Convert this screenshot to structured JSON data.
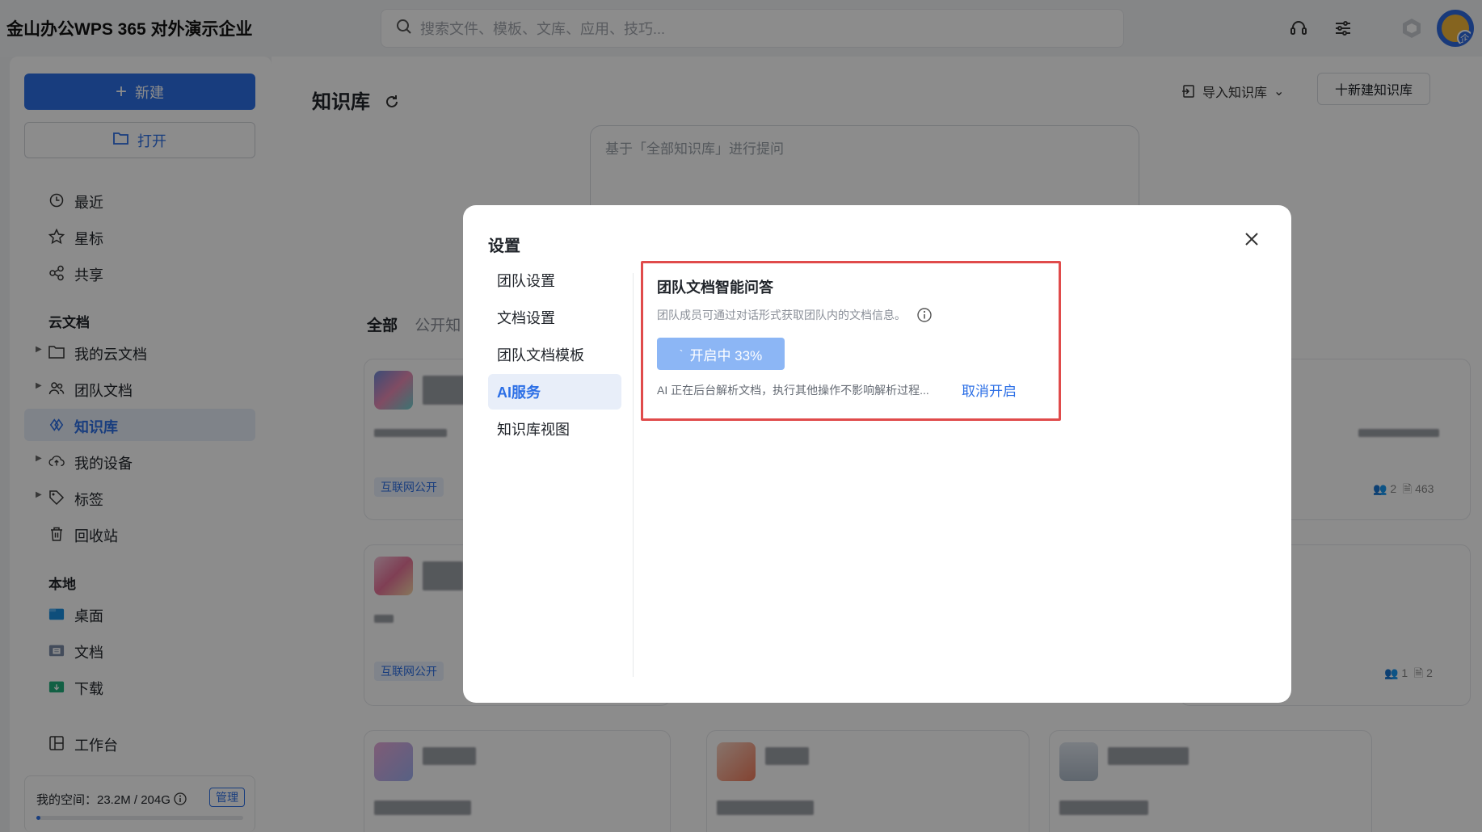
{
  "app": {
    "title": "金山办公WPS 365 对外演示企业"
  },
  "search": {
    "placeholder": "搜索文件、模板、文库、应用、技巧..."
  },
  "topbar": {
    "avatar_badge": "企"
  },
  "sidebar": {
    "new_label": "新建",
    "open_label": "打开",
    "items_top": [
      {
        "label": "最近",
        "icon": "clock-icon"
      },
      {
        "label": "星标",
        "icon": "star-icon"
      },
      {
        "label": "共享",
        "icon": "share-icon"
      }
    ],
    "cloud_section": "云文档",
    "cloud_items": [
      {
        "label": "我的云文档",
        "icon": "folder-icon"
      },
      {
        "label": "团队文档",
        "icon": "team-icon"
      },
      {
        "label": "知识库",
        "icon": "knowledge-icon",
        "active": true
      },
      {
        "label": "我的设备",
        "icon": "cloud-device-icon"
      },
      {
        "label": "标签",
        "icon": "tag-icon"
      },
      {
        "label": "回收站",
        "icon": "trash-icon"
      }
    ],
    "local_section": "本地",
    "local_items": [
      {
        "label": "桌面",
        "icon": "desktop-folder-icon"
      },
      {
        "label": "文档",
        "icon": "documents-folder-icon"
      },
      {
        "label": "下载",
        "icon": "download-folder-icon"
      }
    ],
    "workbench": "工作台",
    "storage": {
      "text": "我的空间：23.2M / 204G",
      "manage": "管理",
      "used_fraction": 0.02
    }
  },
  "main": {
    "title": "知识库",
    "import_label": "导入知识库",
    "new_kb_label": "十新建知识库",
    "ask_placeholder": "基于「全部知识库」进行提问",
    "tabs": [
      "全部",
      "公开知"
    ],
    "cards": [
      {
        "tag": "互联网公开",
        "members": "2",
        "docs": "463"
      },
      {
        "tag": "互联网公开",
        "members": "1",
        "docs": "2"
      }
    ]
  },
  "modal": {
    "title": "设置",
    "nav": [
      "团队设置",
      "文档设置",
      "团队文档模板",
      "AI服务",
      "知识库视图"
    ],
    "active_nav": "AI服务",
    "ai": {
      "heading": "团队文档智能问答",
      "desc": "团队成员可通过对话形式获取团队内的文档信息。",
      "button_label": "开启中 33%",
      "progress_percent": 33,
      "note": "AI 正在后台解析文档，执行其他操作不影响解析过程...",
      "cancel_label": "取消开启"
    }
  },
  "colors": {
    "accent": "#2c6fe6",
    "highlight_border": "#e04b4b",
    "button_loading": "#8cb6f5"
  }
}
